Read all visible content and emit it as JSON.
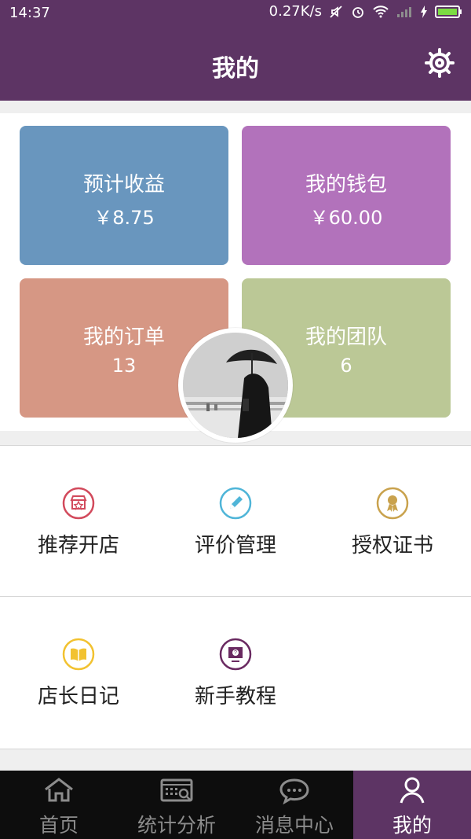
{
  "status_bar": {
    "time": "14:37",
    "speed": "0.27K/s",
    "icons": [
      "mute-icon",
      "alarm-icon",
      "wifi-icon",
      "signal-icon",
      "charging-icon",
      "battery-icon"
    ]
  },
  "header": {
    "title": "我的",
    "settings_icon": "gear-icon"
  },
  "summary": {
    "estimated_earnings": {
      "label": "预计收益",
      "value": "￥8.75"
    },
    "wallet": {
      "label": "我的钱包",
      "value": "￥60.00"
    },
    "orders": {
      "label": "我的订单",
      "value": "13"
    },
    "team": {
      "label": "我的团队",
      "value": "6"
    },
    "avatar_icon": "avatar"
  },
  "menu": {
    "items": [
      {
        "label": "推荐开店",
        "icon": "shop-icon",
        "color": "#d24a5c"
      },
      {
        "label": "评价管理",
        "icon": "pencil-icon",
        "color": "#4fb5d8"
      },
      {
        "label": "授权证书",
        "icon": "award-icon",
        "color": "#c9a24d"
      },
      {
        "label": "店长日记",
        "icon": "book-icon",
        "color": "#f2c230"
      },
      {
        "label": "新手教程",
        "icon": "tutorial-icon",
        "color": "#6a2a61"
      }
    ]
  },
  "bottom_nav": {
    "items": [
      {
        "label": "首页",
        "icon": "home-icon"
      },
      {
        "label": "统计分析",
        "icon": "stats-icon"
      },
      {
        "label": "消息中心",
        "icon": "message-icon"
      },
      {
        "label": "我的",
        "icon": "user-icon",
        "active": true
      }
    ]
  },
  "colors": {
    "brand_purple": "#5d3464",
    "card_blue": "#6996be",
    "card_purple": "#b272bb",
    "card_orange": "#d69784",
    "card_green": "#bbc896"
  }
}
